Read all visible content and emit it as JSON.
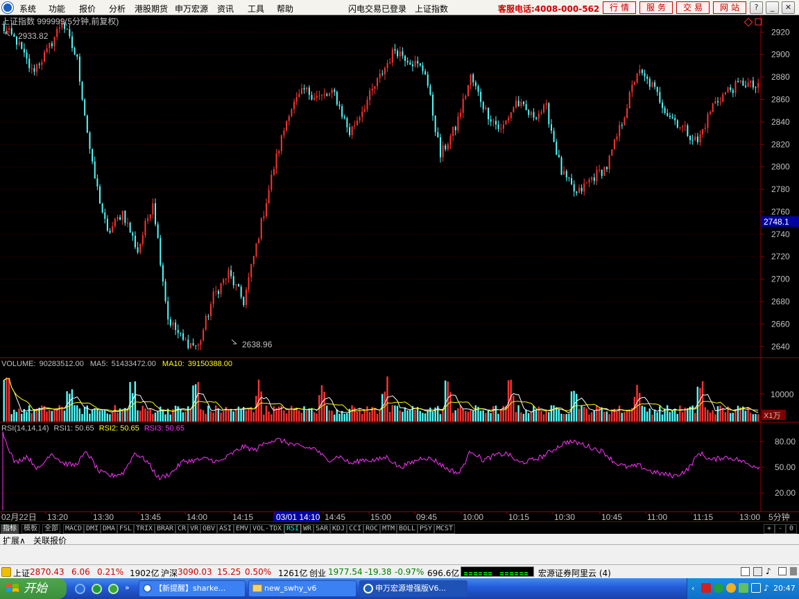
{
  "menu": {
    "items": [
      "系统",
      "功能",
      "报价",
      "分析",
      "港股期货",
      "申万宏源",
      "资讯",
      "工具",
      "帮助"
    ],
    "center": [
      "闪电交易已登录",
      "上证指数"
    ],
    "hotline": "客服电话:4008-000-562",
    "buttons": [
      "行情",
      "服务",
      "交易",
      "网站"
    ],
    "window_controls": [
      "?",
      "_",
      "❐",
      "✕"
    ]
  },
  "price_panel": {
    "title": "上证指数 999999(5分钟,前复权)",
    "high_label": "2933.82",
    "low_label": "2638.96",
    "current_price_tag": "2748.1",
    "y_ticks": [
      "2920",
      "2900",
      "2880",
      "2860",
      "2840",
      "2820",
      "2800",
      "2780",
      "2760",
      "2740",
      "2720",
      "2700",
      "2680",
      "2660",
      "2640"
    ]
  },
  "volume_panel": {
    "label": "VOLUME:",
    "volume_value": "90283512.00",
    "ma5_label": "MA5:",
    "ma5_value": "51433472.00",
    "ma10_label": "MA10:",
    "ma10_value": "39150388.00",
    "y_tick": "10000",
    "unit": "X1万"
  },
  "rsi_panel": {
    "label": "RSI(14,14,14)",
    "rsi1": "RSI1: 50.65",
    "rsi2": "RSI2: 50.65",
    "rsi3": "RSI3: 50.65",
    "y_ticks": [
      "80.00",
      "50.00",
      "20.00"
    ]
  },
  "time_axis": {
    "labels": [
      "02月22日",
      "13:20",
      "13:30",
      "13:45",
      "14:00",
      "14:15",
      "03/01 14:10",
      "14:45",
      "15:00",
      "09:45",
      "10:00",
      "10:15",
      "10:30",
      "10:45",
      "11:00",
      "11:15",
      "13:00"
    ],
    "period": "5分钟"
  },
  "indicator_tabs": [
    "指标",
    "模板",
    "全部",
    "MACD",
    "DMI",
    "DMA",
    "FSL",
    "TRIX",
    "BRAR",
    "CR",
    "VR",
    "OBV",
    "ASI",
    "EMV",
    "VOL-TDX",
    "RSI",
    "WR",
    "SAR",
    "KDJ",
    "CCI",
    "ROC",
    "MTM",
    "BOLL",
    "PSY",
    "MCST"
  ],
  "active_indicator": "RSI",
  "zoom_controls": [
    "+",
    "-",
    "0"
  ],
  "expand_row": [
    "扩展∧",
    "关联报价"
  ],
  "status_bar": {
    "sh_label": "上证",
    "sh_value": "2870.43",
    "sh_change": "6.06",
    "sh_pct": "0.21%",
    "sh_amount": "1902亿",
    "hs_label": "沪深",
    "hs_value": "3090.03",
    "hs_change": "15.25",
    "hs_pct": "0.50%",
    "hs_amount": "1261亿",
    "cy_label": "创业",
    "cy_value": "1977.54",
    "cy_change": "-19.38",
    "cy_pct": "-0.97%",
    "cy_amount": "696.6亿",
    "broker": "宏源证券阿里云 (4)"
  },
  "taskbar": {
    "start_label": "开始",
    "tasks": [
      "【新提醒】sharke...",
      "new_swhy_v6",
      "申万宏源增强版V6..."
    ],
    "clock": "20:47"
  },
  "chart_data": [
    {
      "type": "candlestick",
      "title": "上证指数 999999(5分钟,前复权)",
      "ylim": [
        2630,
        2935
      ],
      "high": 2933.82,
      "low": 2638.96,
      "current": 2748.1,
      "close_keypoints": [
        2925,
        2912,
        2885,
        2902,
        2930,
        2895,
        2800,
        2740,
        2760,
        2725,
        2770,
        2665,
        2645,
        2640,
        2685,
        2705,
        2680,
        2740,
        2800,
        2850,
        2868,
        2862,
        2865,
        2830,
        2855,
        2880,
        2905,
        2895,
        2885,
        2810,
        2835,
        2880,
        2850,
        2832,
        2858,
        2845,
        2852,
        2795,
        2775,
        2790,
        2800,
        2840,
        2885,
        2872,
        2848,
        2835,
        2822,
        2855,
        2868,
        2875,
        2870
      ],
      "colors": {
        "up": "#ff3232",
        "down": "#54fcfc"
      }
    },
    {
      "type": "bar",
      "title": "VOLUME",
      "series": [
        {
          "name": "VOLUME",
          "value": 90283512.0
        },
        {
          "name": "MA5",
          "value": 51433472.0
        },
        {
          "name": "MA10",
          "value": 39150388.0
        }
      ],
      "y_tick": 10000,
      "unit": "X1万"
    },
    {
      "type": "line",
      "title": "RSI(14,14,14)",
      "ylim": [
        0,
        100
      ],
      "y_ticks": [
        20,
        50,
        80
      ],
      "keypoints": [
        90,
        55,
        63,
        47,
        67,
        55,
        52,
        68,
        45,
        40,
        43,
        67,
        57,
        37,
        43,
        57,
        58,
        60,
        56,
        65,
        74,
        70,
        80,
        82,
        77,
        73,
        72,
        58,
        63,
        54,
        59,
        58,
        62,
        50,
        55,
        62,
        58,
        48,
        43,
        70,
        58,
        64,
        66,
        55,
        58,
        63,
        72,
        80,
        78,
        73,
        68,
        55,
        50,
        52,
        45,
        42,
        40,
        47,
        67,
        58,
        62,
        60,
        54,
        50
      ],
      "final": 50.65,
      "color": "#ff33ff"
    }
  ]
}
